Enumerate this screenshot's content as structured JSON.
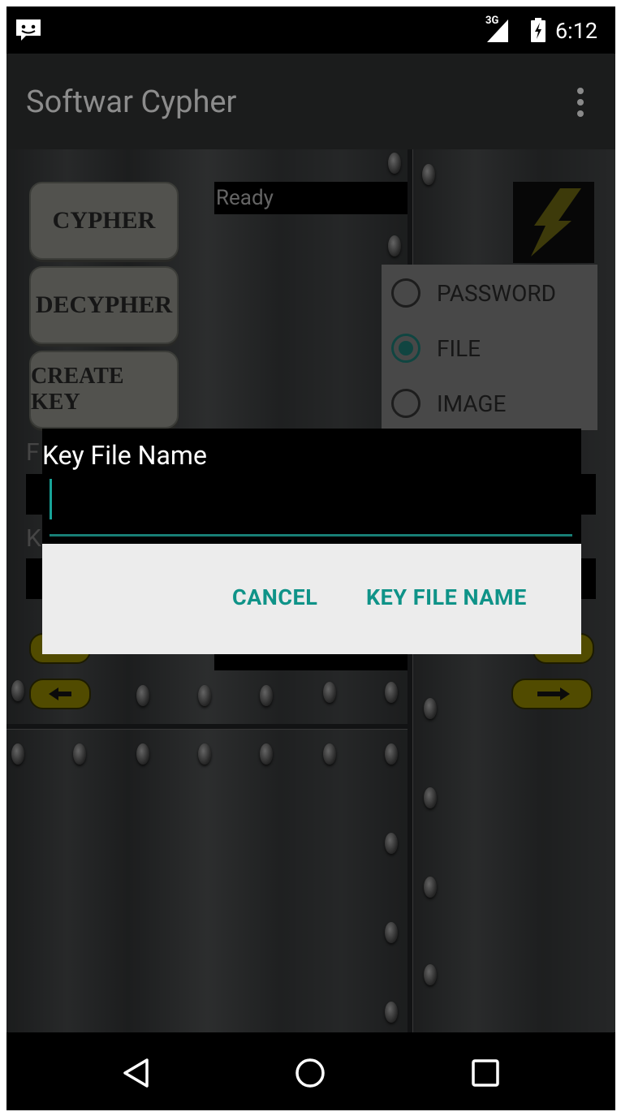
{
  "status_bar": {
    "network_type": "3G",
    "time": "6:12",
    "icons": [
      "notification-message-icon",
      "signal-icon",
      "battery-charging-icon"
    ]
  },
  "app_bar": {
    "title": "Softwar Cypher",
    "overflow_icon": "more-vert-icon"
  },
  "main": {
    "buttons": [
      {
        "label": "CYPHER"
      },
      {
        "label": "DECYPHER"
      },
      {
        "label": "CREATE KEY"
      }
    ],
    "status_text": "Ready",
    "logo_icon": "lightning-bolt-icon",
    "mode_options": [
      {
        "label": "PASSWORD",
        "checked": false
      },
      {
        "label": "FILE",
        "checked": true
      },
      {
        "label": "IMAGE",
        "checked": false
      }
    ],
    "partial_labels": [
      "F",
      "K"
    ]
  },
  "dialog": {
    "title": "Key File Name",
    "input_value": "",
    "cancel_label": "CANCEL",
    "confirm_label": "KEY FILE NAME"
  },
  "nav_bar": {
    "icons": [
      "back-icon",
      "home-icon",
      "recents-icon"
    ]
  },
  "colors": {
    "accent": "#0f9388",
    "dialog_background": "#ececec",
    "title_text": "#8c8c8c"
  }
}
